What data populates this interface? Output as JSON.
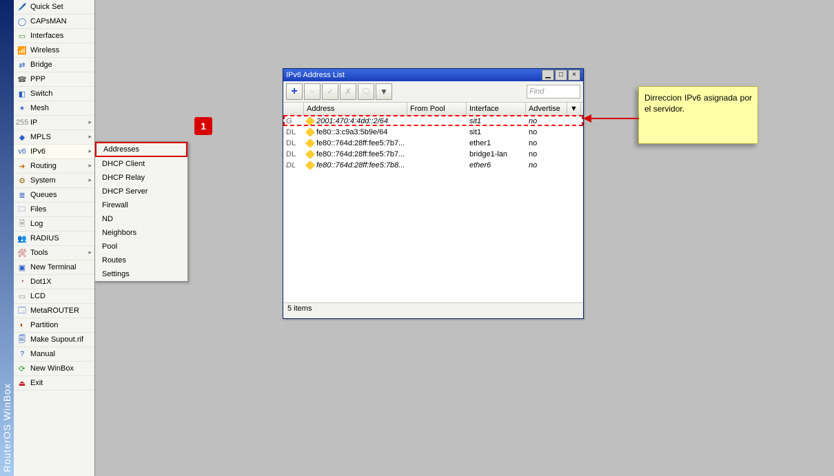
{
  "app_title": "RouterOS WinBox",
  "sidebar": {
    "items": [
      {
        "label": "Quick Set",
        "icon": "🖊️",
        "color": "#caa300"
      },
      {
        "label": "CAPsMAN",
        "icon": "◯",
        "color": "#2a60c8"
      },
      {
        "label": "Interfaces",
        "icon": "▭",
        "color": "#3a8e3a"
      },
      {
        "label": "Wireless",
        "icon": "📶",
        "color": "#2a60c8"
      },
      {
        "label": "Bridge",
        "icon": "⇄",
        "color": "#2a60c8"
      },
      {
        "label": "PPP",
        "icon": "☎",
        "color": "#555"
      },
      {
        "label": "Switch",
        "icon": "◧",
        "color": "#2a60c8"
      },
      {
        "label": "Mesh",
        "icon": "✶",
        "color": "#2a60c8"
      },
      {
        "label": "IP",
        "icon": "255",
        "color": "#888",
        "arrow": true
      },
      {
        "label": "MPLS",
        "icon": "◆",
        "color": "#2a60c8",
        "arrow": true
      },
      {
        "label": "IPv6",
        "icon": "v6",
        "color": "#2a60c8",
        "arrow": true,
        "selected": true
      },
      {
        "label": "Routing",
        "icon": "➜",
        "color": "#d07000",
        "arrow": true
      },
      {
        "label": "System",
        "icon": "⚙",
        "color": "#8a6a00",
        "arrow": true
      },
      {
        "label": "Queues",
        "icon": "≣",
        "color": "#2a60c8"
      },
      {
        "label": "Files",
        "icon": "🗀",
        "color": "#2a60c8"
      },
      {
        "label": "Log",
        "icon": "🗎",
        "color": "#888"
      },
      {
        "label": "RADIUS",
        "icon": "👥",
        "color": "#e0b000"
      },
      {
        "label": "Tools",
        "icon": "🛠",
        "color": "#b02020",
        "arrow": true
      },
      {
        "label": "New Terminal",
        "icon": "▣",
        "color": "#2a60c8"
      },
      {
        "label": "Dot1X",
        "icon": "◔",
        "color": "#c04080"
      },
      {
        "label": "LCD",
        "icon": "▭",
        "color": "#888"
      },
      {
        "label": "MetaROUTER",
        "icon": "🗔",
        "color": "#2a60c8"
      },
      {
        "label": "Partition",
        "icon": "◐",
        "color": "#c04000"
      },
      {
        "label": "Make Supout.rif",
        "icon": "🗐",
        "color": "#2a60c8"
      },
      {
        "label": "Manual",
        "icon": "?",
        "color": "#2a60c8"
      },
      {
        "label": "New WinBox",
        "icon": "⟳",
        "color": "#20a020"
      },
      {
        "label": "Exit",
        "icon": "⏏",
        "color": "#c02020"
      }
    ]
  },
  "submenu": {
    "items": [
      {
        "label": "Addresses",
        "selected": true
      },
      {
        "label": "DHCP Client"
      },
      {
        "label": "DHCP Relay"
      },
      {
        "label": "DHCP Server"
      },
      {
        "label": "Firewall"
      },
      {
        "label": "ND"
      },
      {
        "label": "Neighbors"
      },
      {
        "label": "Pool"
      },
      {
        "label": "Routes"
      },
      {
        "label": "Settings"
      }
    ]
  },
  "badge": "1",
  "window": {
    "title": "IPv6 Address List",
    "find_placeholder": "Find",
    "columns": {
      "address": "Address",
      "from_pool": "From Pool",
      "interface": "Interface",
      "advertise": "Advertise"
    },
    "rows": [
      {
        "flags": "G",
        "address": "2001:470:4:4dd::2/64",
        "from_pool": "",
        "interface": "sit1",
        "advertise": "no",
        "italic": true
      },
      {
        "flags": "DL",
        "address": "fe80::3:c9a3:5b9e/64",
        "from_pool": "",
        "interface": "sit1",
        "advertise": "no"
      },
      {
        "flags": "DL",
        "address": "fe80::764d:28ff:fee5:7b7...",
        "from_pool": "",
        "interface": "ether1",
        "advertise": "no"
      },
      {
        "flags": "DL",
        "address": "fe80::764d:28ff:fee5:7b7...",
        "from_pool": "",
        "interface": "bridge1-lan",
        "advertise": "no"
      },
      {
        "flags": "DL",
        "address": "fe80::764d:28ff:fee5:7b8...",
        "from_pool": "",
        "interface": "ether6",
        "advertise": "no",
        "italic": true
      }
    ],
    "status": "5 items"
  },
  "callout": {
    "line1": "Dirreccion IPv6",
    "line2": "asignada por el",
    "line3": "servidor."
  }
}
